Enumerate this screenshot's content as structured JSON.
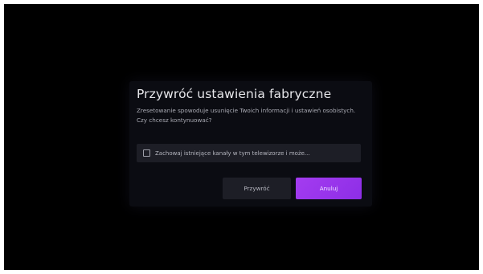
{
  "dialog": {
    "title": "Przywróć ustawienia fabryczne",
    "message": "Zresetowanie spowoduje usunięcie Twoich informacji i ustawień osobistych. Czy chcesz kontynuować?",
    "checkbox": {
      "label": "Zachowaj istniejące kanały w tym telewizorze i może...",
      "checked": false
    },
    "buttons": {
      "reset_label": "Przywróć",
      "cancel_label": "Anuluj"
    }
  },
  "colors": {
    "background": "#000000",
    "dialog": "#0b0c12",
    "accent": "#a43cf0"
  }
}
